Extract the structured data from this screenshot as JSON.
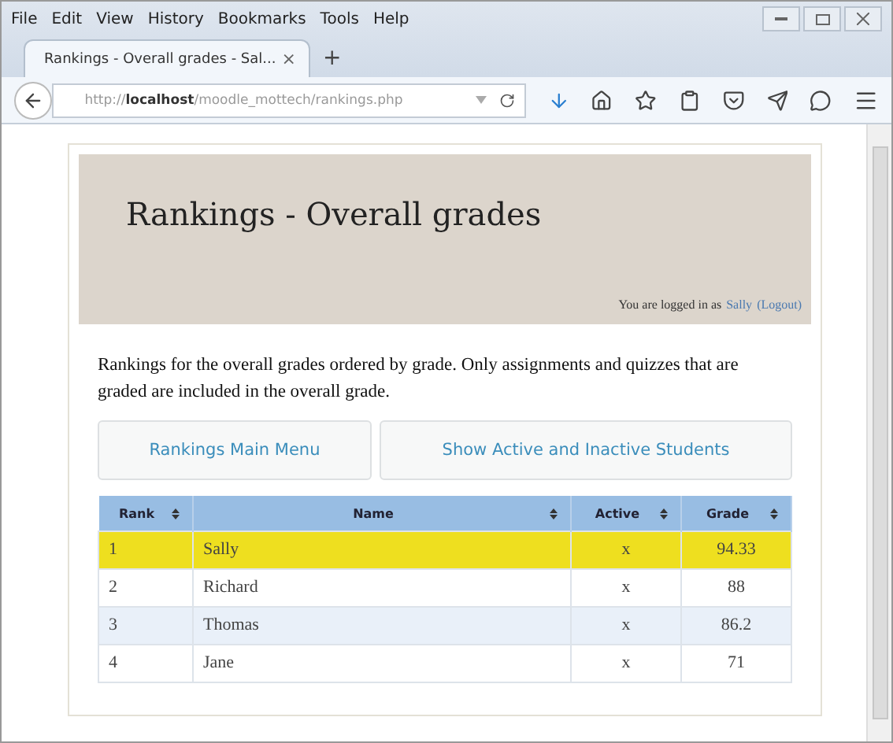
{
  "menu": [
    "File",
    "Edit",
    "View",
    "History",
    "Bookmarks",
    "Tools",
    "Help"
  ],
  "tabs": [
    {
      "label": "Rankings - Overall grades - Sal...",
      "close": "×",
      "selected": true
    }
  ],
  "new_tab": "+",
  "address": {
    "url": "http://**localhost**/moodle_mottech/rankings.php"
  },
  "page": {
    "title": "Rankings - Overall grades",
    "login": {
      "prefix": "You are logged in as",
      "user": "Sally",
      "logout": "(Logout)"
    },
    "intro": "Rankings for the overall grades ordered by grade. Only assignments and quizzes that are graded are included in the overall grade.",
    "buttons": [
      "Rankings Main Menu",
      "Show Active and Inactive Students"
    ],
    "table": {
      "columns": [
        "Rank",
        "Name",
        "Active",
        "Grade"
      ],
      "rows": [
        {
          "cells": [
            "1",
            "Sally",
            "x",
            "94.33"
          ],
          "highlighted": true
        },
        {
          "cells": [
            "2",
            "Richard",
            "x",
            "88"
          ],
          "highlighted": false
        },
        {
          "cells": [
            "3",
            "Thomas",
            "x",
            "86.2"
          ],
          "highlighted": false
        },
        {
          "cells": [
            "4",
            "Jane",
            "x",
            "71"
          ],
          "highlighted": false
        }
      ]
    }
  }
}
